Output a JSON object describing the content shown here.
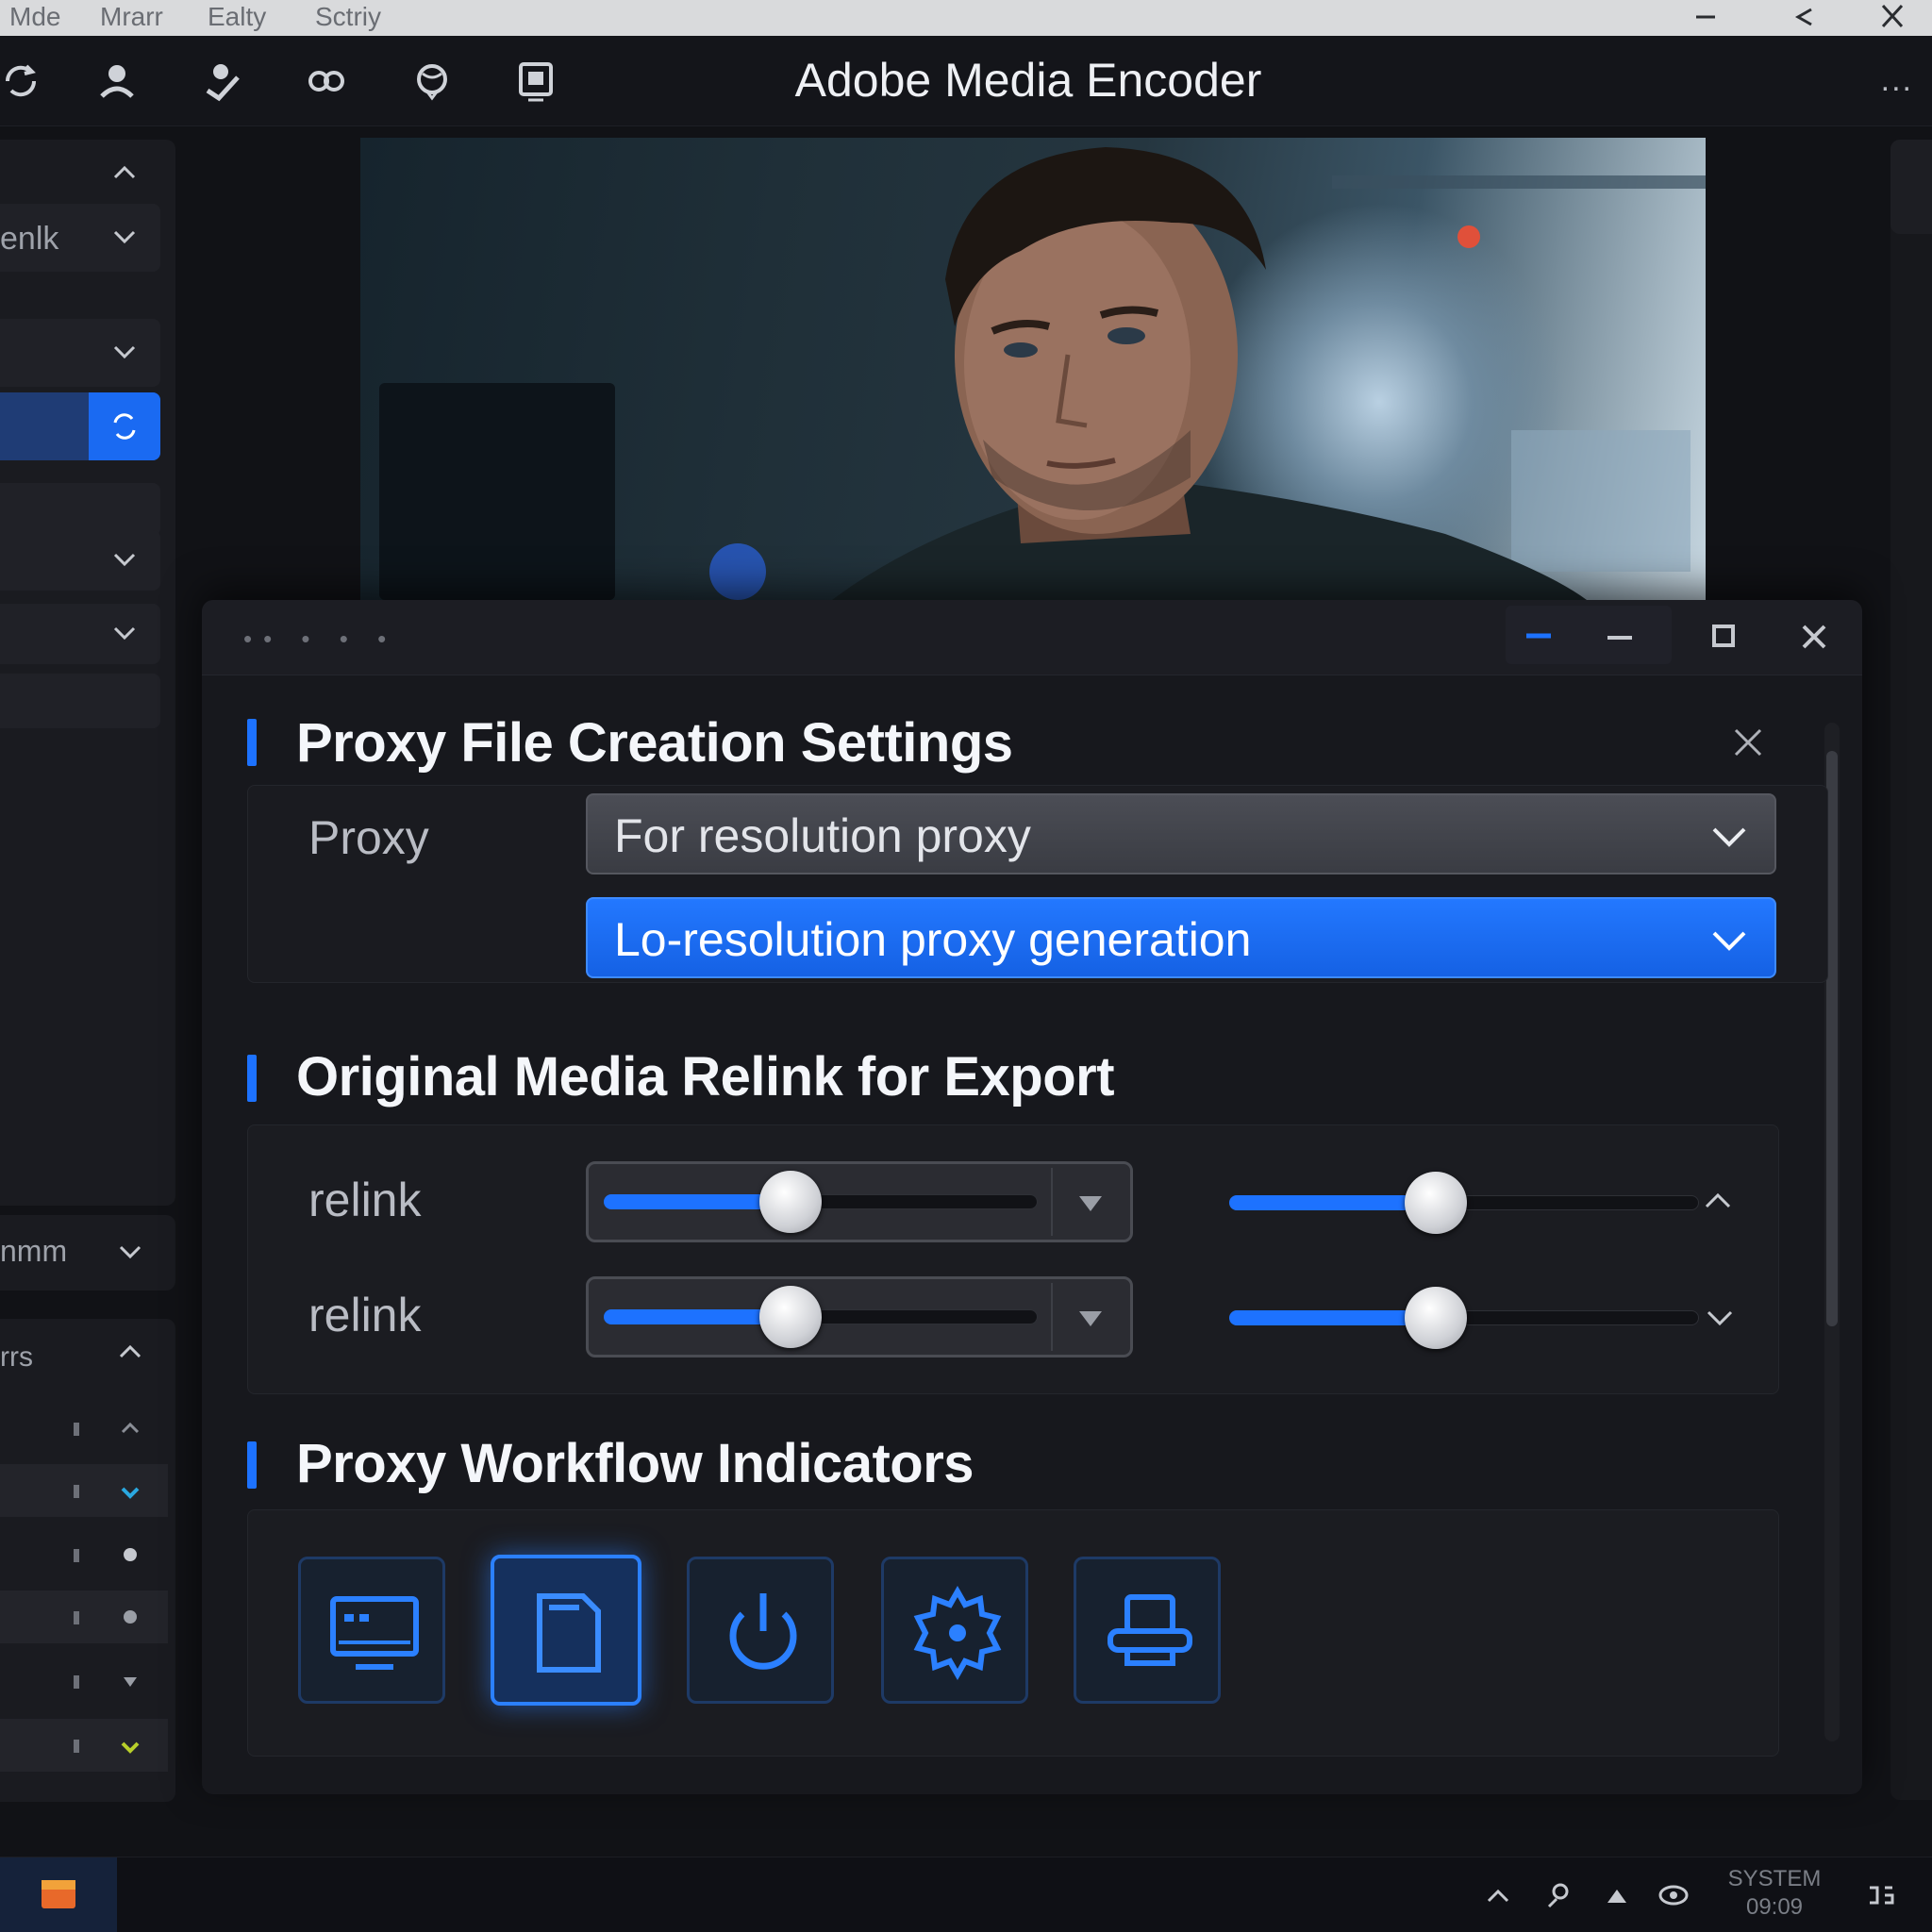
{
  "os_menubar": {
    "menus": [
      "Mde",
      "Mrarr",
      "Ealty",
      "Sctriy"
    ]
  },
  "app": {
    "title": "Adobe Media Encoder",
    "toolbar_icons": [
      "sync-icon",
      "user-icon",
      "user-check-icon",
      "link-icon",
      "globe-icon",
      "device-icon"
    ],
    "more": "..."
  },
  "left_panel": {
    "items": [
      {
        "label": ""
      },
      {
        "label": "enlk"
      },
      {
        "label": ""
      },
      {
        "label": ""
      },
      {
        "label": ""
      },
      {
        "label": ""
      },
      {
        "label": ""
      }
    ],
    "footer_label": "nmm",
    "list_header": "rrs"
  },
  "dialog": {
    "window_dots": "•• • • •",
    "section1": {
      "title": "Proxy File Creation Settings",
      "proxy_label": "Proxy",
      "select_primary": "For resolution proxy",
      "select_secondary": "Lo-resolution proxy generation"
    },
    "section2": {
      "title": "Original Media Relink for Export",
      "rows": [
        {
          "label": "relink",
          "slider_a": 0.43,
          "slider_b": 0.44
        },
        {
          "label": "relink",
          "slider_a": 0.43,
          "slider_b": 0.44
        }
      ]
    },
    "section3": {
      "title": "Proxy Workflow Indicators",
      "indicators": [
        "monitor-icon",
        "document-icon",
        "power-icon",
        "gear-icon",
        "printer-icon"
      ],
      "selected_index": 1
    }
  },
  "taskbar": {
    "clock_line1": "SYSTEM",
    "clock_line2": "09:09"
  },
  "colors": {
    "accent": "#1d72ff",
    "background": "#17181d"
  }
}
